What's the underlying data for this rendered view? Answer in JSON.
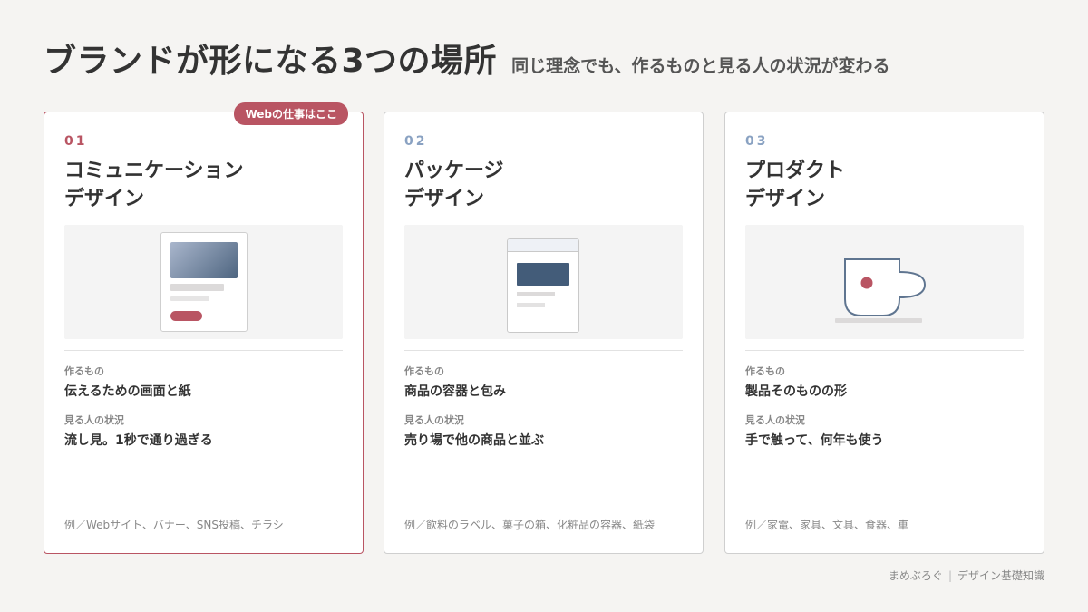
{
  "header": {
    "title": "ブランドが形になる3つの場所",
    "subtitle": "同じ理念でも、作るものと見る人の状況が変わる"
  },
  "cards": [
    {
      "badge": "Webの仕事はここ",
      "number": "01",
      "title_line1": "コミュニケーション",
      "title_line2": "デザイン",
      "illustration": "web-page-icon",
      "make_label": "作るもの",
      "make_value": "伝えるための画面と紙",
      "viewer_label": "見る人の状況",
      "viewer_value": "流し見。1秒で通り過ぎる",
      "example": "例／Webサイト、バナー、SNS投稿、チラシ"
    },
    {
      "number": "02",
      "title_line1": "パッケージ",
      "title_line2": "デザイン",
      "illustration": "package-box-icon",
      "make_label": "作るもの",
      "make_value": "商品の容器と包み",
      "viewer_label": "見る人の状況",
      "viewer_value": "売り場で他の商品と並ぶ",
      "example": "例／飲料のラベル、菓子の箱、化粧品の容器、紙袋"
    },
    {
      "number": "03",
      "title_line1": "プロダクト",
      "title_line2": "デザイン",
      "illustration": "mug-cup-icon",
      "make_label": "作るもの",
      "make_value": "製品そのものの形",
      "viewer_label": "見る人の状況",
      "viewer_value": "手で触って、何年も使う",
      "example": "例／家電、家具、文具、食器、車"
    }
  ],
  "footer": {
    "site": "まめぶろぐ",
    "separator": "|",
    "category": "デザイン基礎知識"
  },
  "colors": {
    "accent": "#b95563",
    "number_blue": "#8aa2c2",
    "navy": "#435c79",
    "background": "#f5f4f2"
  }
}
